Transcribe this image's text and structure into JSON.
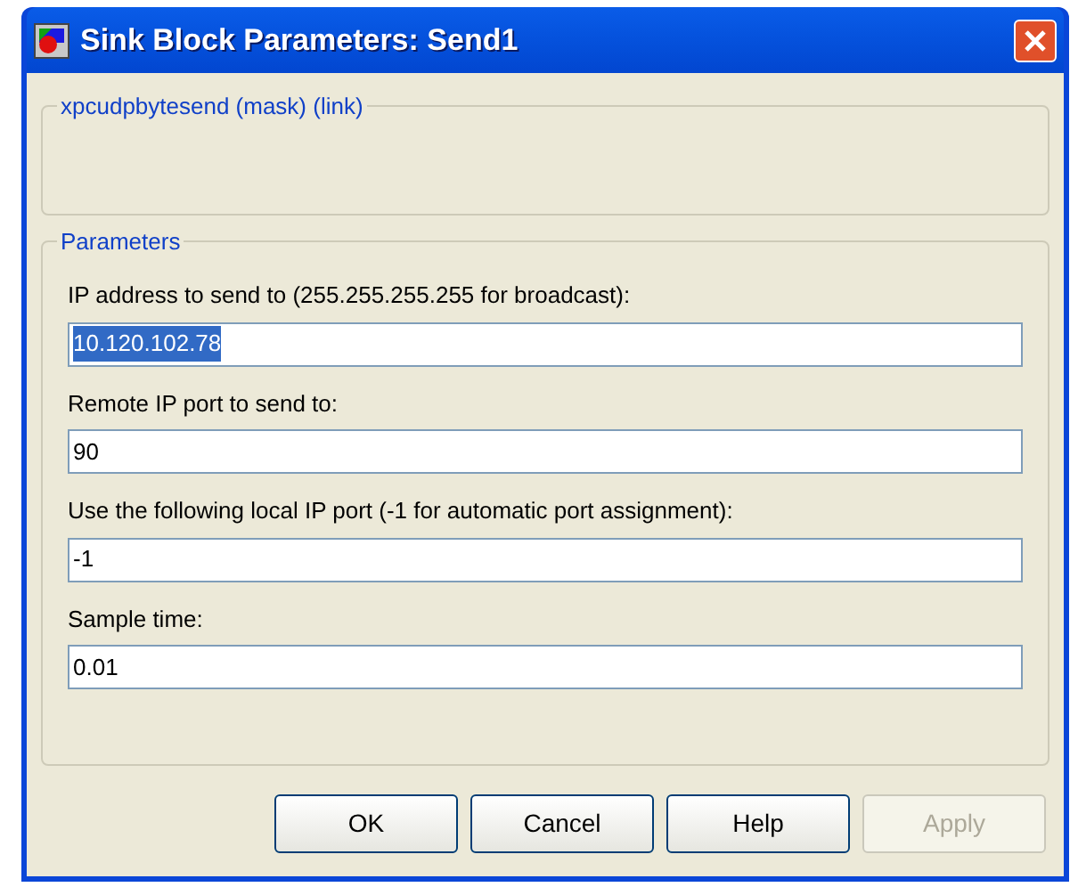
{
  "window": {
    "title": "Sink Block Parameters: Send1"
  },
  "mask_group": {
    "title": "xpcudpbytesend (mask) (link)"
  },
  "parameters": {
    "title": "Parameters",
    "fields": [
      {
        "label": "IP address to send to (255.255.255.255 for broadcast):",
        "value": "10.120.102.78",
        "text_selected": true
      },
      {
        "label": "Remote IP port to send to:",
        "value": "90",
        "text_selected": false
      },
      {
        "label": "Use the following local IP port (-1 for automatic port assignment):",
        "value": "-1",
        "text_selected": false
      },
      {
        "label": "Sample time:",
        "value": "0.01",
        "text_selected": false
      }
    ]
  },
  "buttons": [
    {
      "label": "OK",
      "disabled": false
    },
    {
      "label": "Cancel",
      "disabled": false
    },
    {
      "label": "Help",
      "disabled": false
    },
    {
      "label": "Apply",
      "disabled": true
    }
  ]
}
